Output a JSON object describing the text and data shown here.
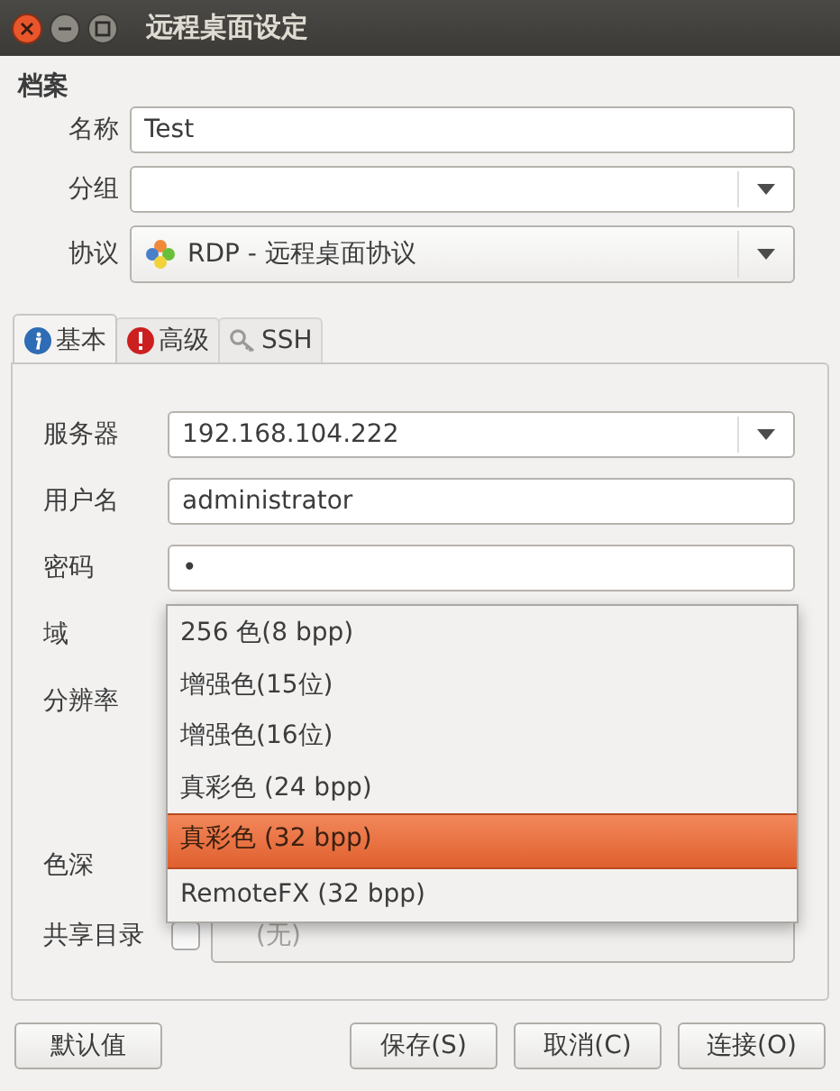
{
  "window": {
    "title": "远程桌面设定"
  },
  "profile": {
    "heading": "档案",
    "fields": [
      {
        "label": "名称",
        "kind": "text",
        "value": "Test"
      },
      {
        "label": "分组",
        "kind": "combo"
      },
      {
        "label": "协议",
        "kind": "combo",
        "value": "RDP - 远程桌面协议"
      }
    ]
  },
  "tabs": [
    {
      "label": "基本",
      "selected": true
    },
    {
      "label": "高级",
      "selected": false
    },
    {
      "label": "SSH",
      "selected": false
    }
  ],
  "basic": {
    "fields": [
      {
        "label": "服务器",
        "kind": "combo",
        "value": "192.168.104.222"
      },
      {
        "label": "用户名",
        "kind": "text",
        "value": "administrator"
      },
      {
        "label": "密码",
        "kind": "text",
        "value": "•"
      },
      {
        "label": "域",
        "kind": "label"
      },
      {
        "label": "分辨率",
        "kind": "tall"
      },
      {
        "label": "色深",
        "kind": "label"
      },
      {
        "label": "共享目录",
        "kind": "share",
        "checked": false,
        "value": "(无)",
        "disabled": true
      }
    ]
  },
  "popup": {
    "options": [
      {
        "label": "256 色(8 bpp)",
        "selected": false
      },
      {
        "label": "增强色(15位)",
        "selected": false
      },
      {
        "label": "增强色(16位)",
        "selected": false
      },
      {
        "label": "真彩色 (24 bpp)",
        "selected": false
      },
      {
        "label": "真彩色 (32 bpp)",
        "selected": true
      },
      {
        "label": "RemoteFX (32 bpp)",
        "selected": false
      }
    ]
  },
  "buttons": [
    {
      "label": "默认值",
      "kind": "left"
    },
    {
      "label": "保存(S)",
      "kind": "right"
    },
    {
      "label": "取消(C)",
      "kind": "right"
    },
    {
      "label": "连接(O)",
      "kind": "right"
    }
  ]
}
